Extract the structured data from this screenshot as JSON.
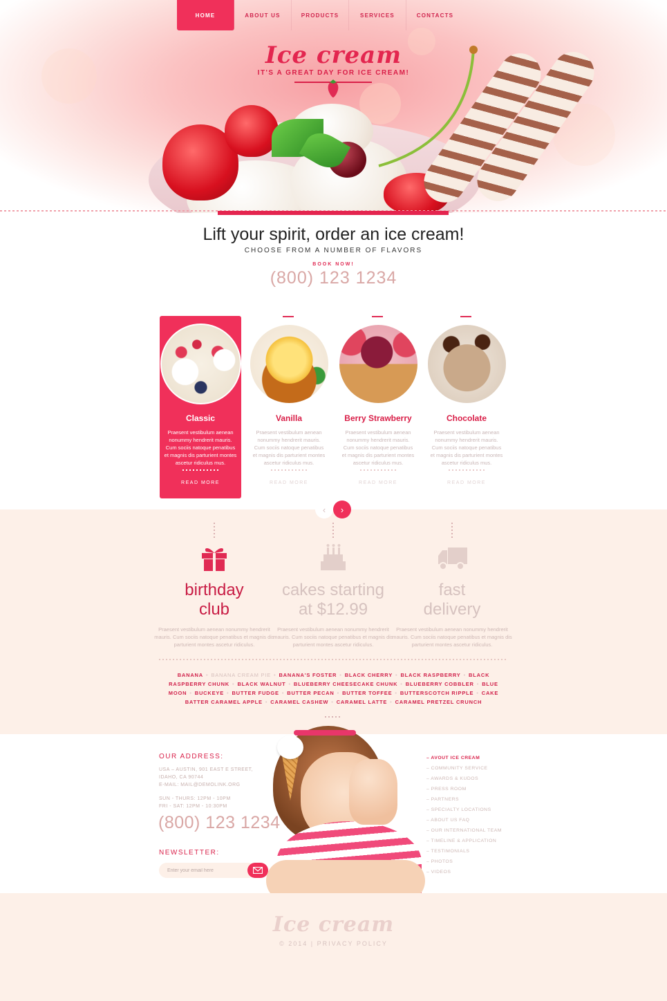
{
  "nav": {
    "items": [
      {
        "label": "HOME",
        "active": true
      },
      {
        "label": "ABOUT US"
      },
      {
        "label": "PRODUCTS"
      },
      {
        "label": "SERVICES"
      },
      {
        "label": "CONTACTS"
      }
    ]
  },
  "hero": {
    "logo": "Ice cream",
    "tagline": "IT'S A GREAT DAY FOR ICE CREAM!"
  },
  "intro": {
    "title": "Lift your spirit, order an ice cream!",
    "subtitle": "CHOOSE FROM A NUMBER OF FLAVORS",
    "book_label": "BOOK NOW!",
    "phone": "(800) 123 1234"
  },
  "products": [
    {
      "title": "Classic",
      "text": "Praesent vestibulum aenean nonummy hendrerit mauris. Cum sociis natoque penatibus et magnis dis parturient montes ascetur ridiculus mus.",
      "more": "READ MORE",
      "active": true
    },
    {
      "title": "Vanilla",
      "text": "Praesent vestibulum aenean nonummy hendrerit mauris. Cum sociis natoque penatibus et magnis dis parturient montes ascetur ridiculus mus.",
      "more": "READ MORE"
    },
    {
      "title": "Berry Strawberry",
      "text": "Praesent vestibulum aenean nonummy hendrerit mauris. Cum sociis natoque penatibus et magnis dis parturient montes ascetur ridiculus mus.",
      "more": "READ MORE"
    },
    {
      "title": "Chocolate",
      "text": "Praesent vestibulum aenean nonummy hendrerit mauris. Cum sociis natoque penatibus et magnis dis parturient montes ascetur ridiculus mus.",
      "more": "READ MORE"
    }
  ],
  "carousel": {
    "prev": "‹",
    "next": "›"
  },
  "features": [
    {
      "icon": "gift-icon",
      "title_1": "birthday",
      "title_2": "club",
      "text": "Praesent vestibulum aenean nonummy hendrerit mauris. Cum sociis natoque penatibus et magnis dis parturient montes ascetur ridiculus.",
      "active": true
    },
    {
      "icon": "cake-icon",
      "title_1": "cakes starting",
      "title_2": "at $12.99",
      "text": "Praesent vestibulum aenean nonummy hendrerit mauris. Cum sociis natoque penatibus et magnis dis parturient montes ascetur ridiculus."
    },
    {
      "icon": "delivery-truck-icon",
      "title_1": "fast",
      "title_2": "delivery",
      "text": "Praesent vestibulum aenean nonummy hendrerit mauris. Cum sociis natoque penatibus et magnis dis parturient montes ascetur ridiculus."
    }
  ],
  "flavors": [
    {
      "label": "BANANA"
    },
    {
      "label": "BANANA CREAM PIE",
      "dim": true
    },
    {
      "label": "BANANA'S FOSTER"
    },
    {
      "label": "BLACK CHERRY"
    },
    {
      "label": "BLACK RASPBERRY"
    },
    {
      "label": "BLACK RASPBERRY CHUNK"
    },
    {
      "label": "BLACK WALNUT"
    },
    {
      "label": "BLUEBERRY CHEESECAKE CHUNK"
    },
    {
      "label": "BLUEBERRY COBBLER"
    },
    {
      "label": "BLUE MOON"
    },
    {
      "label": "BUCKEYE"
    },
    {
      "label": "BUTTER FUDGE"
    },
    {
      "label": "BUTTER PECAN"
    },
    {
      "label": "BUTTER TOFFEE"
    },
    {
      "label": "BUTTERSCOTCH RIPPLE"
    },
    {
      "label": "CAKE BATTER CARAMEL APPLE"
    },
    {
      "label": "CARAMEL CASHEW"
    },
    {
      "label": "CARAMEL LATTE"
    },
    {
      "label": "CARAMEL PRETZEL CRUNCH"
    }
  ],
  "address": {
    "heading": "OUR ADDRESS:",
    "line1": "USA – AUSTIN, 901 EAST E STREET,",
    "line2": "IDAHO, CA 90744",
    "email": "E-MAIL: MAIL@DEMOLINK.ORG",
    "hours1": "SUN - THURS: 12PM - 10PM",
    "hours2": "FRI - SAT: 12PM - 10:30PM",
    "phone": "(800) 123 1234"
  },
  "newsletter": {
    "heading": "NEWSLETTER:",
    "placeholder": "Enter your email here"
  },
  "links": [
    {
      "label": "AVOUT ICE CREAM",
      "active": true
    },
    {
      "label": "COMMUNITY SERVICE"
    },
    {
      "label": "AWARDS & KUDOS"
    },
    {
      "label": "PRESS ROOM"
    },
    {
      "label": "PARTNERS"
    },
    {
      "label": "SPECIALTY LOCATIONS"
    },
    {
      "label": "ABOUT US FAQ"
    },
    {
      "label": "OUR INTERNATIONAL TEAM"
    },
    {
      "label": "TIMELINE & APPLICATION"
    },
    {
      "label": "TESTIMONIALS"
    },
    {
      "label": "PHOTOS"
    },
    {
      "label": "VIDEOS"
    }
  ],
  "footer": {
    "logo": "Ice cream",
    "copyright": "© 2014 | PRIVACY POLICY"
  },
  "colors": {
    "accent": "#f0305a",
    "accent_dark": "#d91f48",
    "cream_bg": "#fdf0e8"
  }
}
